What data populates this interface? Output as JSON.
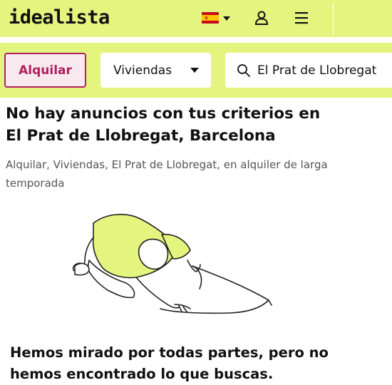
{
  "header": {
    "logo": "idealista",
    "language_flag": "spain-flag-icon",
    "icons": [
      "chevron-down-icon",
      "user-icon",
      "menu-icon"
    ]
  },
  "search": {
    "operation_label": "Alquilar",
    "property_type": "Viviendas",
    "location": "El Prat de Llobregat"
  },
  "results": {
    "title_line1": "No hay anuncios con tus criterios en",
    "title_line2": "El Prat de Llobregat, Barcelona",
    "subtitle": "Alquilar, Viviendas, El Prat de Llobregat, en alquiler de larga temporada",
    "message_line1": "Hemos mirado por todas partes, pero no",
    "message_line2": "hemos encontrado lo que buscas."
  },
  "colors": {
    "brand_lime": "#e3f57f",
    "accent_magenta": "#b0205e",
    "text": "#111111",
    "muted_text": "#555555"
  }
}
